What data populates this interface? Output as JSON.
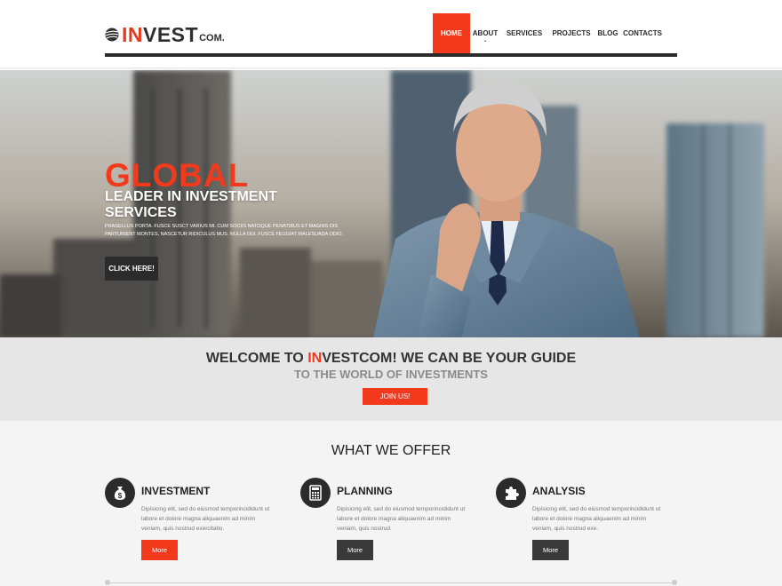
{
  "logo": {
    "in": "IN",
    "vest": "VEST",
    "com": "COM."
  },
  "nav": {
    "items": [
      "HOME",
      "ABOUT",
      "SERVICES",
      "PROJECTS",
      "BLOG",
      "CONTACTS"
    ],
    "active": "HOME",
    "active_color": "#f2391c"
  },
  "hero": {
    "title": "GLOBAL",
    "subtitle": "LEADER IN INVESTMENT SERVICES",
    "text": "PHASELLUS PORTA. FUSCE SUSCT VARIUS MI. CUM SOCIIS NATOQUE PENATIBUS ET MAGNIS DIS PARTURIENT MONTES, NASCETUR RIDICULUS MUS. NULLA DUI. FUSCE FEUGIAT MALESUADA ODIO.",
    "button": "CLICK HERE!"
  },
  "welcome": {
    "line1_pre": "WELCOME TO ",
    "line1_hl": "IN",
    "line1_post": "VESTCOM! WE CAN BE YOUR GUIDE",
    "line2": "TO THE WORLD OF INVESTMENTS",
    "button": "JOIN US!"
  },
  "offer": {
    "title": "WHAT WE OFFER",
    "cards": [
      {
        "icon": "money-bag-icon",
        "title": "INVESTMENT",
        "text": "Dipisicing elit, sed do eiusmod temporincididunt ut labore et dolore magna aliquaenim ad minim veniam, quis nostrud exercitatio.",
        "button": "More"
      },
      {
        "icon": "calculator-icon",
        "title": "PLANNING",
        "text": "Dipisicing elit, sed do eiusmod temporincididunt ut labore et dolore magna aliquaenim ad minim veniam, quis nostrud.",
        "button": "More"
      },
      {
        "icon": "puzzle-icon",
        "title": "ANALYSIS",
        "text": "Dipisicing elit, sed do eiusmod temporincididunt ut labore et dolore magna aliquaenim ad minim veniam, quis nostrud exe.",
        "button": "More"
      }
    ]
  },
  "colors": {
    "accent": "#f2391c",
    "dark": "#2b2b2b"
  }
}
